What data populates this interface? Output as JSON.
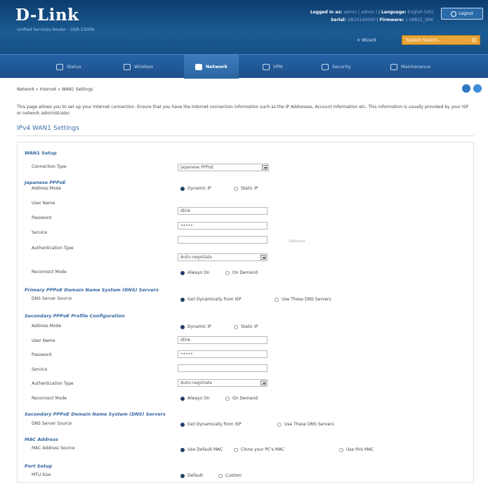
{
  "brand": {
    "logo": "D-Link",
    "subtitle": "Unified Services Router - DSR-1000N"
  },
  "header": {
    "logged_in_label": "Logged in as:",
    "logged_in_value": "admin ( admin )",
    "language_label": "Language:",
    "language_value": "English [US]",
    "serial_label": "Serial:",
    "serial_value": "QB2X1A0000",
    "firmware_label": "Firmware:",
    "firmware_value": "1.08B22_WW",
    "logout_label": "Logout",
    "wizard_label": "Wizard",
    "search_placeholder": "System Search..."
  },
  "nav": {
    "items": [
      {
        "label": "Status",
        "icon": "dashboard-icon"
      },
      {
        "label": "Wireless",
        "icon": "wifi-icon"
      },
      {
        "label": "Network",
        "icon": "network-icon",
        "active": true
      },
      {
        "label": "VPN",
        "icon": "cloud-icon"
      },
      {
        "label": "Security",
        "icon": "lock-icon"
      },
      {
        "label": "Maintenance",
        "icon": "gear-icon"
      }
    ]
  },
  "breadcrumb": "Network  »  Internet  »  WAN1 Settings",
  "intro": "This page allows you to set up your Internet connection. Ensure that you have the Internet connection information such as the IP Addresses, Account Information etc. This information is usually provided by your ISP or network administrator.",
  "page_title": "IPv4 WAN1 Settings",
  "form": {
    "wan1_setup": {
      "title": "WAN1 Setup",
      "connection_type_label": "Connection Type",
      "connection_type_value": "Japanese PPPoE"
    },
    "japanese_pppoe": {
      "title": "Japanese PPPoE",
      "address_mode_label": "Address Mode",
      "dynamic_ip": "Dynamic IP",
      "static_ip": "Static IP",
      "user_name_label": "User Name",
      "user_name_value": "dlink",
      "password_label": "Password",
      "password_value": "•••••",
      "service_label": "Service",
      "service_value": "",
      "optional": "Optional",
      "auth_type_label": "Authentication Type",
      "auth_type_value": "Auto-negotiate",
      "reconnect_label": "Reconnect Mode",
      "always_on": "Always On",
      "on_demand": "On Demand"
    },
    "primary_dns": {
      "title": "Primary PPPoE Domain Name System (DNS) Servers",
      "source_label": "DNS Server Source",
      "opt_isp": "Get Dynamically from ISP",
      "opt_these": "Use These DNS Servers"
    },
    "secondary_profile": {
      "title": "Secondary PPPoE Profile Configuration",
      "address_mode_label": "Address Mode",
      "dynamic_ip": "Dynamic IP",
      "static_ip": "Static IP",
      "user_name_label": "User Name",
      "user_name_value": "dlink",
      "password_label": "Password",
      "password_value": "•••••",
      "service_label": "Service",
      "service_value": "",
      "auth_type_label": "Authentication Type",
      "auth_type_value": "Auto-negotiate",
      "reconnect_label": "Reconnect Mode",
      "always_on": "Always On",
      "on_demand": "On Demand"
    },
    "secondary_dns": {
      "title": "Secondary PPPoE Domain Name System (DNS) Servers",
      "source_label": "DNS Server Source",
      "opt_isp": "Get Dynamically from ISP",
      "opt_these": "Use These DNS Servers"
    },
    "mac": {
      "title": "MAC Address",
      "source_label": "MAC Address Source",
      "opt_default": "Use Default MAC",
      "opt_clone": "Clone your PC's MAC",
      "opt_this": "Use this MAC"
    },
    "port": {
      "title": "Port Setup",
      "mtu_label": "MTU Size",
      "opt_default": "Default",
      "opt_custom": "Custom"
    }
  }
}
